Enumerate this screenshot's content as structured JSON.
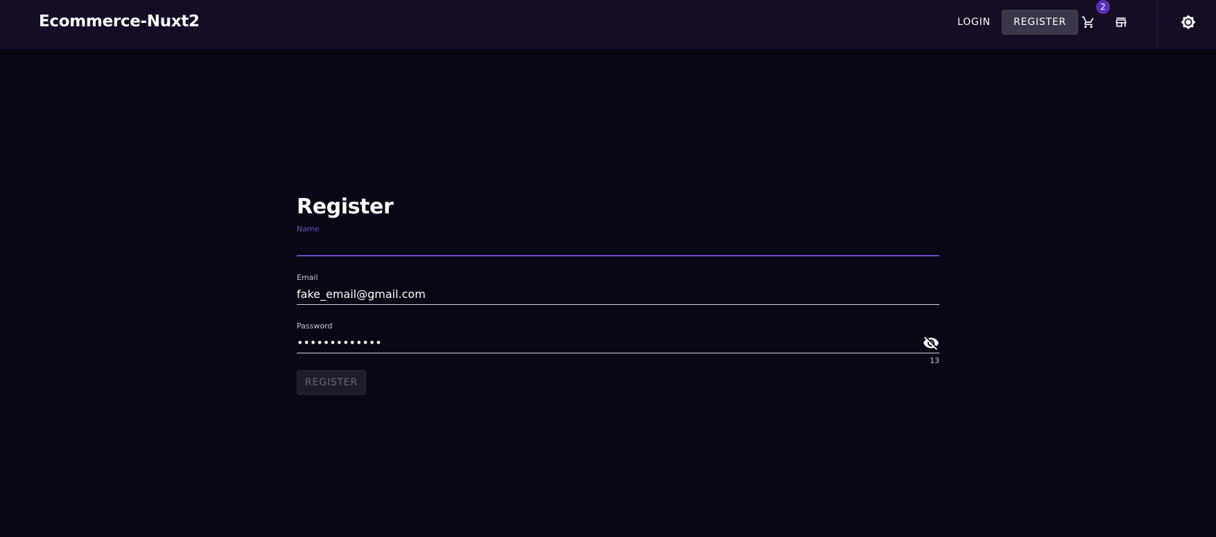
{
  "header": {
    "brand": "Ecommerce-Nuxt2",
    "login_label": "LOGIN",
    "register_label": "REGISTER",
    "cart_count": "2",
    "icons": {
      "cart": "cart-icon",
      "store": "store-icon",
      "theme": "brightness-icon"
    }
  },
  "form": {
    "title": "Register",
    "name": {
      "label": "Name",
      "value": ""
    },
    "email": {
      "label": "Email",
      "value": "fake_email@gmail.com"
    },
    "password": {
      "label": "Password",
      "value": "•••••••••••••",
      "counter": "13",
      "icon": "eye-off-icon"
    },
    "submit_label": "REGISTER"
  },
  "colors": {
    "background": "#0a0714",
    "app_bar": "#150d24",
    "accent": "#6b4bc4",
    "badge": "#5b2fb8"
  }
}
